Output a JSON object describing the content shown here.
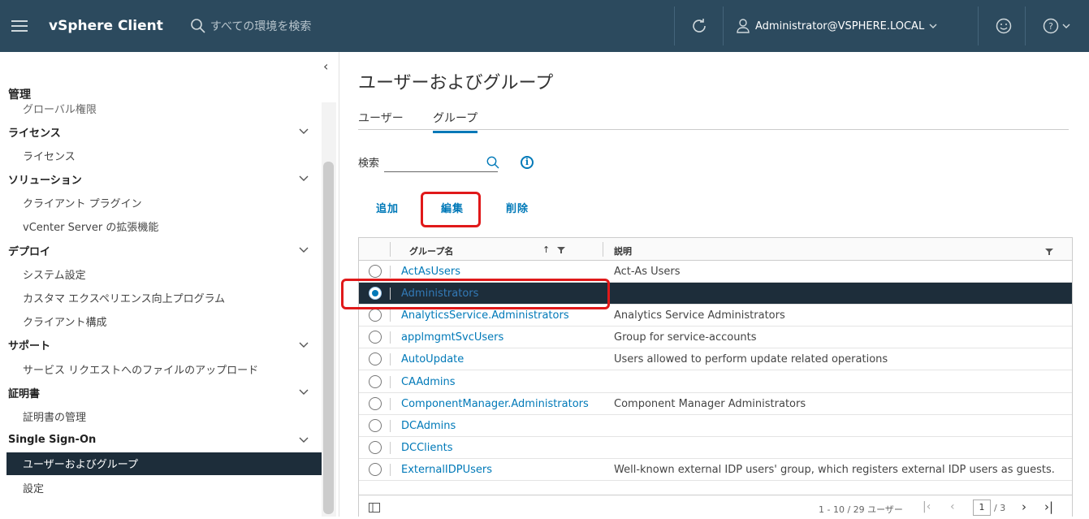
{
  "header": {
    "app_title": "vSphere Client",
    "search_placeholder": "すべての環境を検索",
    "user": "Administrator@VSPHERE.LOCAL"
  },
  "sidebar": {
    "title": "管理",
    "cut_item": "グローバル権限",
    "rows": [
      {
        "type": "section",
        "label": "ライセンス"
      },
      {
        "type": "item",
        "label": "ライセンス"
      },
      {
        "type": "section",
        "label": "ソリューション"
      },
      {
        "type": "item",
        "label": "クライアント プラグイン"
      },
      {
        "type": "item",
        "label": "vCenter Server の拡張機能"
      },
      {
        "type": "section",
        "label": "デプロイ"
      },
      {
        "type": "item",
        "label": "システム設定"
      },
      {
        "type": "item",
        "label": "カスタマ エクスペリエンス向上プログラム"
      },
      {
        "type": "item",
        "label": "クライアント構成"
      },
      {
        "type": "section",
        "label": "サポート"
      },
      {
        "type": "item",
        "label": "サービス リクエストへのファイルのアップロード"
      },
      {
        "type": "section",
        "label": "証明書"
      },
      {
        "type": "item",
        "label": "証明書の管理"
      },
      {
        "type": "section",
        "label": "Single Sign-On"
      },
      {
        "type": "item",
        "label": "ユーザーおよびグループ",
        "active": true
      },
      {
        "type": "item",
        "label": "設定"
      }
    ]
  },
  "main": {
    "title": "ユーザーおよびグループ",
    "tabs": [
      {
        "label": "ユーザー",
        "active": false
      },
      {
        "label": "グループ",
        "active": true
      }
    ],
    "search_label": "検索",
    "actions": {
      "add": "追加",
      "edit": "編集",
      "delete": "削除"
    },
    "grid": {
      "col_name": "グループ名",
      "col_desc": "説明",
      "rows": [
        {
          "name": "ActAsUsers",
          "desc": "Act-As Users",
          "selected": false
        },
        {
          "name": "Administrators",
          "desc": "",
          "selected": true
        },
        {
          "name": "AnalyticsService.Administrators",
          "desc": "Analytics Service Administrators",
          "selected": false
        },
        {
          "name": "applmgmtSvcUsers",
          "desc": "Group for service-accounts",
          "selected": false
        },
        {
          "name": "AutoUpdate",
          "desc": "Users allowed to perform update related operations",
          "selected": false
        },
        {
          "name": "CAAdmins",
          "desc": "",
          "selected": false
        },
        {
          "name": "ComponentManager.Administrators",
          "desc": "Component Manager Administrators",
          "selected": false
        },
        {
          "name": "DCAdmins",
          "desc": "",
          "selected": false
        },
        {
          "name": "DCClients",
          "desc": "",
          "selected": false
        },
        {
          "name": "ExternalIDPUsers",
          "desc": "Well-known external IDP users' group, which registers external IDP users as guests.",
          "selected": false
        }
      ],
      "footer": {
        "range": "1 - 10 / 29 ユーザー",
        "page": "1",
        "total_pages": "/ 3"
      }
    }
  },
  "colors": {
    "header_bg": "#2c4a5e",
    "accent": "#0079b8",
    "selected_row": "#1d2d3a",
    "highlight": "#e0191a"
  }
}
